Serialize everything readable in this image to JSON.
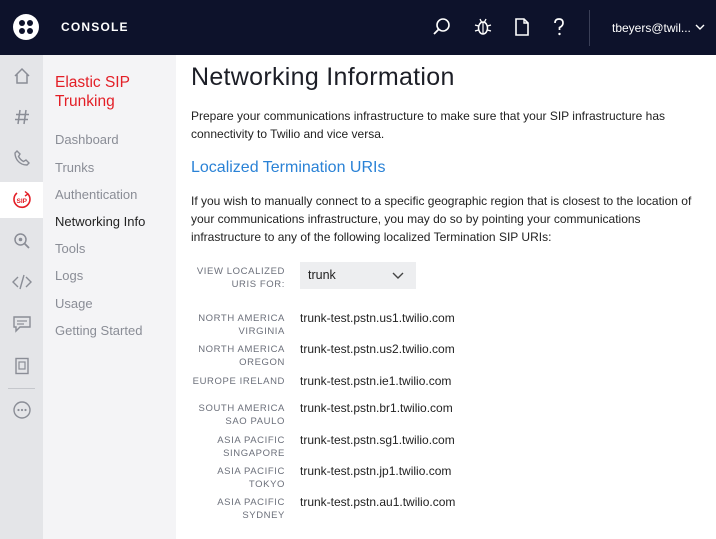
{
  "header": {
    "brand": "CONSOLE",
    "account": "tbeyers@twil...",
    "icons": [
      "search-icon",
      "debugger-icon",
      "document-icon",
      "help-icon"
    ]
  },
  "rail": {
    "items": [
      "home-icon",
      "hash-icon",
      "phone-icon",
      "sip-icon",
      "search-zoom-icon",
      "code-icon",
      "chat-icon",
      "book-icon",
      "more-icon"
    ],
    "active": "sip-icon"
  },
  "subnav": {
    "title": "Elastic SIP Trunking",
    "items": [
      "Dashboard",
      "Trunks",
      "Authentication",
      "Networking Info",
      "Tools",
      "Logs",
      "Usage",
      "Getting Started"
    ],
    "active": "Networking Info"
  },
  "main": {
    "title": "Networking Information",
    "intro": "Prepare your communications infrastructure to make sure that your SIP infrastructure has connectivity to Twilio and vice versa.",
    "section_title": "Localized Termination URIs",
    "section_text": "If you wish to manually connect to a specific geographic region that is closest to the location of your communications infrastructure, you may do so by pointing your communications infrastructure to any of the following localized Termination SIP URIs:",
    "select_label": "VIEW LOCALIZED URIS FOR:",
    "select_value": "trunk",
    "uris": [
      {
        "region": "NORTH AMERICA VIRGINIA",
        "uri": "trunk-test.pstn.us1.twilio.com"
      },
      {
        "region": "NORTH AMERICA OREGON",
        "uri": "trunk-test.pstn.us2.twilio.com"
      },
      {
        "region": "EUROPE IRELAND",
        "uri": "trunk-test.pstn.ie1.twilio.com"
      },
      {
        "region": "SOUTH AMERICA SAO PAULO",
        "uri": "trunk-test.pstn.br1.twilio.com"
      },
      {
        "region": "ASIA PACIFIC SINGAPORE",
        "uri": "trunk-test.pstn.sg1.twilio.com"
      },
      {
        "region": "ASIA PACIFIC TOKYO",
        "uri": "trunk-test.pstn.jp1.twilio.com"
      },
      {
        "region": "ASIA PACIFIC SYDNEY",
        "uri": "trunk-test.pstn.au1.twilio.com"
      }
    ]
  },
  "colors": {
    "topbar": "#0d122b",
    "accent_red": "#e31e26",
    "link_blue": "#2a82d6"
  }
}
